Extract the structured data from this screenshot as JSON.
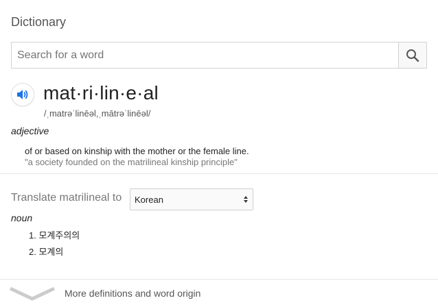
{
  "header": {
    "title": "Dictionary"
  },
  "search": {
    "placeholder": "Search for a word",
    "value": "",
    "button_icon": "search-icon"
  },
  "entry": {
    "audio_icon": "speaker-icon",
    "word": "mat·ri·lin·e·al",
    "pronunciation": "/ˌmatrəˈlinēəl,ˌmātrəˈlinēəl/",
    "part_of_speech": "adjective",
    "definition": "of or based on kinship with the mother or the female line.",
    "example": "\"a society founded on the matrilineal kinship principle\""
  },
  "translate": {
    "label": "Translate matrilineal to",
    "language": "Korean",
    "part_of_speech": "noun",
    "items": [
      {
        "label": "1. 모계주의의"
      },
      {
        "label": "2. 모계의"
      }
    ]
  },
  "footer": {
    "more_label": "More definitions and word origin",
    "expand_icon": "chevron-down-icon"
  },
  "colors": {
    "accent": "#1a73e8",
    "muted_text": "#777777",
    "border": "#d2d2d2"
  }
}
